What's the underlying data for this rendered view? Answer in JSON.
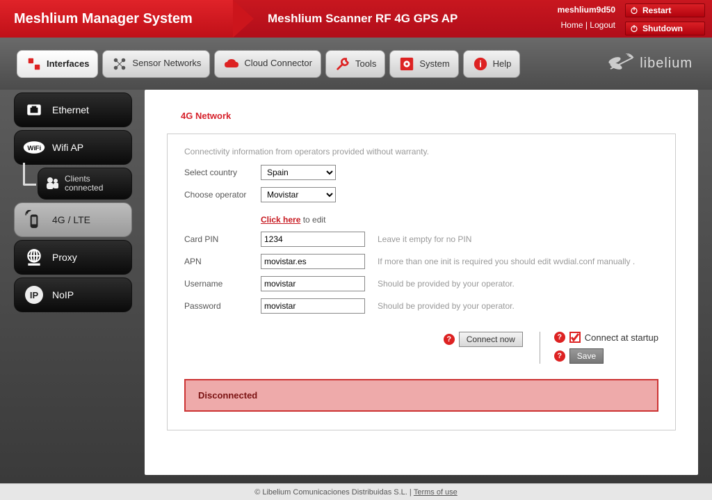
{
  "header": {
    "title": "Meshlium Manager System",
    "subtitle": "Meshlium Scanner RF 4G GPS AP",
    "hostname": "meshlium9d50",
    "home": "Home",
    "logout": "Logout",
    "restart": "Restart",
    "shutdown": "Shutdown"
  },
  "tabs": {
    "interfaces": "Interfaces",
    "sensor": "Sensor Networks",
    "cloud": "Cloud Connector",
    "tools": "Tools",
    "system": "System",
    "help": "Help"
  },
  "logo": "libelium",
  "sidebar": {
    "ethernet": "Ethernet",
    "wifi": "Wifi AP",
    "clients": "Clients connected",
    "lte": "4G / LTE",
    "proxy": "Proxy",
    "noip": "NoIP",
    "noip_icon": "IP"
  },
  "section": {
    "title": "4G Network"
  },
  "panel": {
    "info": "Connectivity information from operators provided without warranty.",
    "select_country_label": "Select country",
    "select_country_value": "Spain",
    "choose_operator_label": "Choose operator",
    "choose_operator_value": "Movistar",
    "edit_link": "Click here",
    "edit_suffix": " to edit",
    "pin_label": "Card PIN",
    "pin_value": "1234",
    "pin_hint": "Leave it empty for no PIN",
    "apn_label": "APN",
    "apn_value": "movistar.es",
    "apn_hint": "If more than one init is required you should edit wvdial.conf manually .",
    "user_label": "Username",
    "user_value": "movistar",
    "user_hint": "Should be provided by your operator.",
    "pass_label": "Password",
    "pass_value": "movistar",
    "pass_hint": "Should be provided by your operator."
  },
  "actions": {
    "connect": "Connect now",
    "startup": "Connect at startup",
    "save": "Save"
  },
  "status": {
    "text": "Disconnected"
  },
  "footer": {
    "copyright": "© Libelium Comunicaciones Distribuidas S.L. |",
    "terms": "Terms of use"
  }
}
